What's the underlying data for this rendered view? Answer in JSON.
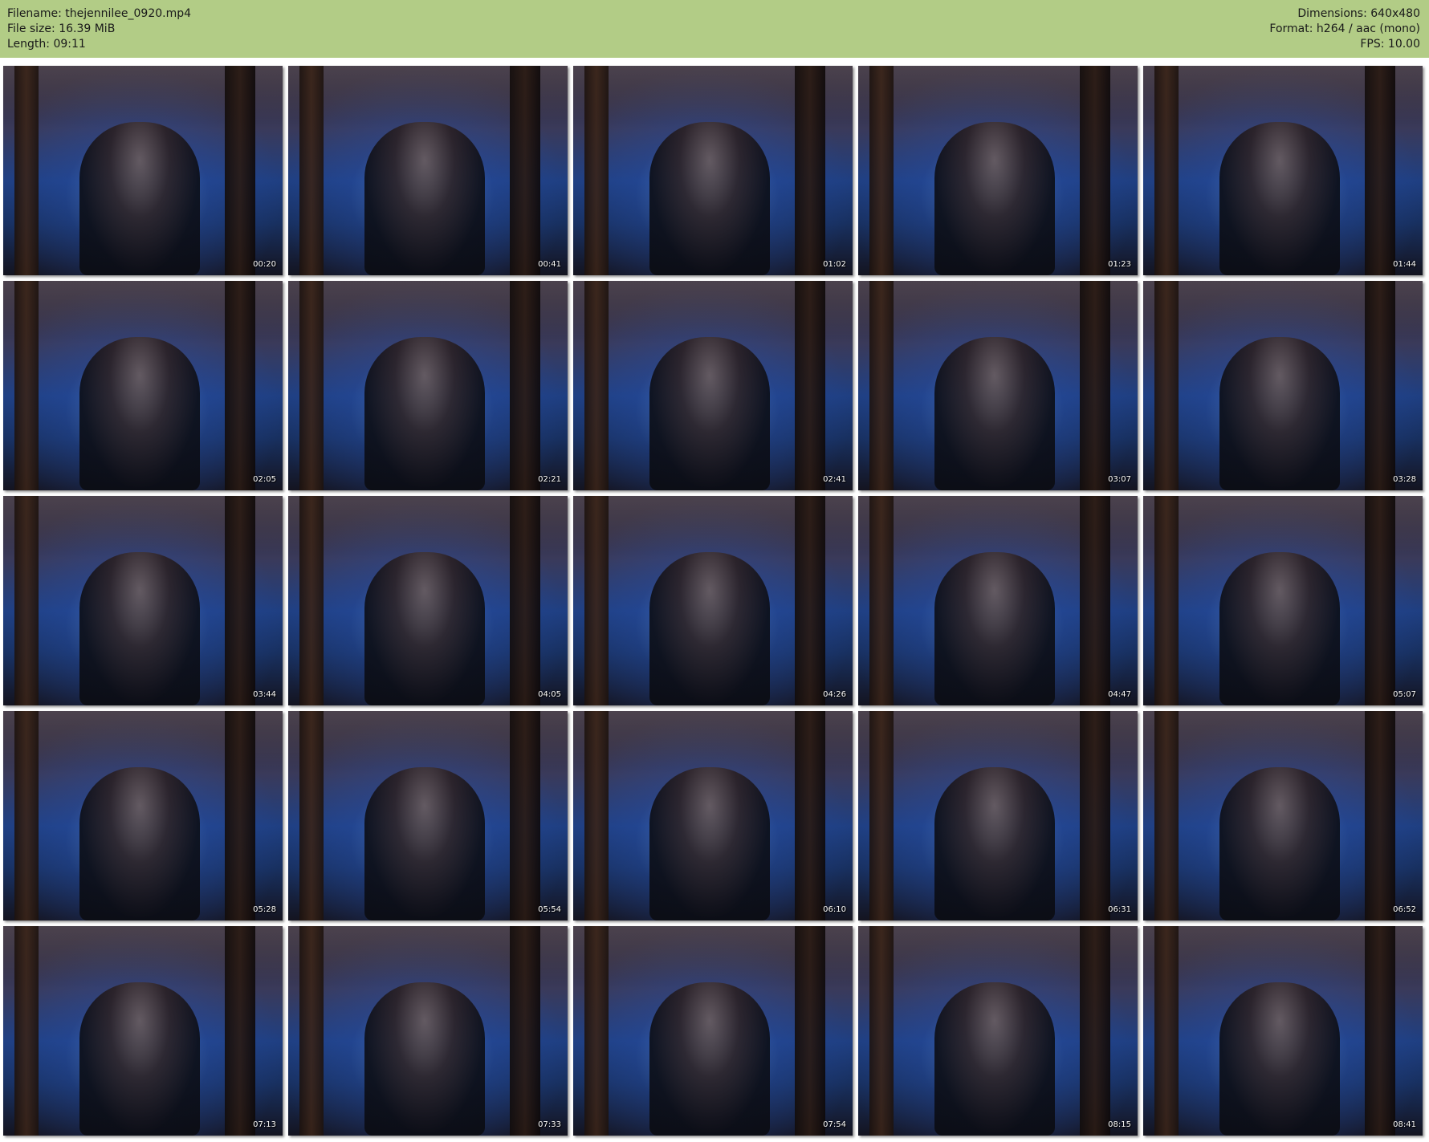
{
  "header": {
    "left": [
      "Filename: thejennilee_0920.mp4",
      "File size: 16.39 MiB",
      "Length: 09:11"
    ],
    "right": [
      "Dimensions: 640x480",
      "Format: h264 / aac (mono)",
      "FPS: 10.00"
    ],
    "background_color": "#b2cc86"
  },
  "thumbnails": [
    {
      "timestamp": "00:20"
    },
    {
      "timestamp": "00:41"
    },
    {
      "timestamp": "01:02"
    },
    {
      "timestamp": "01:23"
    },
    {
      "timestamp": "01:44"
    },
    {
      "timestamp": "02:05"
    },
    {
      "timestamp": "02:21"
    },
    {
      "timestamp": "02:41"
    },
    {
      "timestamp": "03:07"
    },
    {
      "timestamp": "03:28"
    },
    {
      "timestamp": "03:44"
    },
    {
      "timestamp": "04:05"
    },
    {
      "timestamp": "04:26"
    },
    {
      "timestamp": "04:47"
    },
    {
      "timestamp": "05:07"
    },
    {
      "timestamp": "05:28"
    },
    {
      "timestamp": "05:54"
    },
    {
      "timestamp": "06:10"
    },
    {
      "timestamp": "06:31"
    },
    {
      "timestamp": "06:52"
    },
    {
      "timestamp": "07:13"
    },
    {
      "timestamp": "07:33"
    },
    {
      "timestamp": "07:54"
    },
    {
      "timestamp": "08:15"
    },
    {
      "timestamp": "08:41"
    }
  ]
}
